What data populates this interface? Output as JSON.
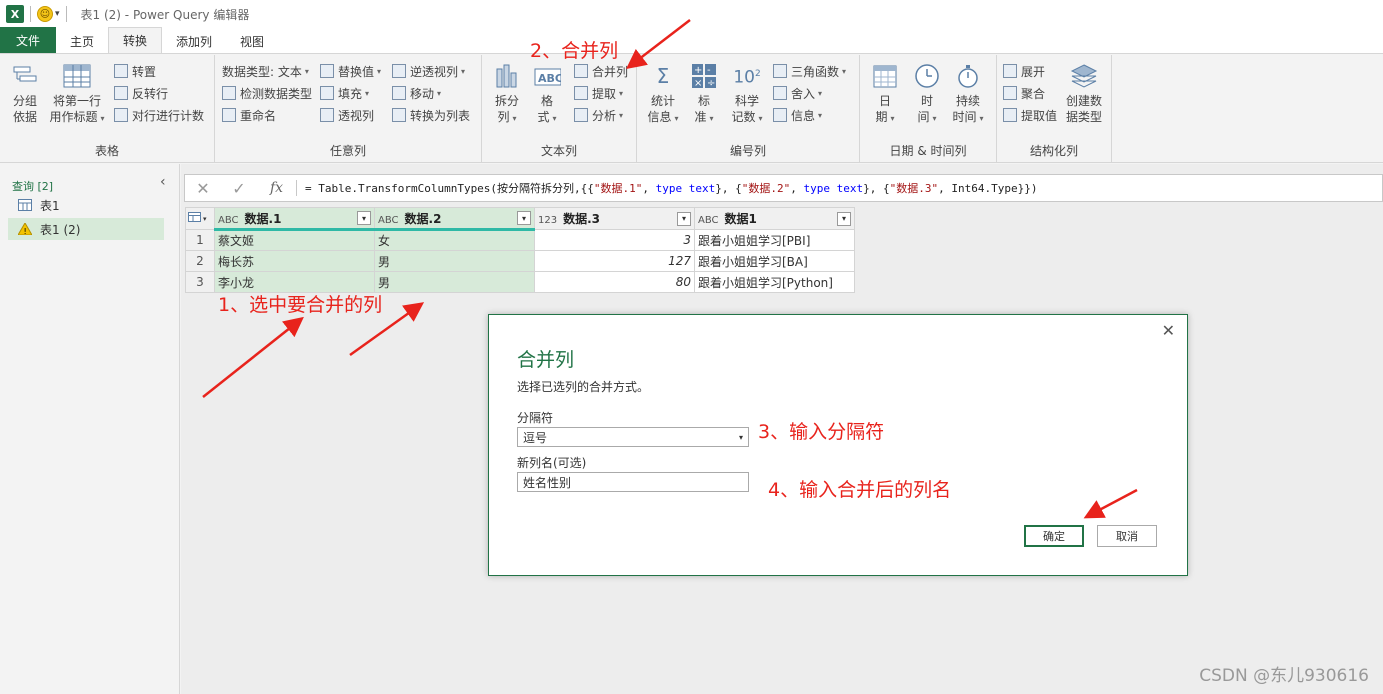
{
  "window": {
    "title": "表1 (2) - Power Query 编辑器",
    "quick_access_dropdown": "▾"
  },
  "tabs": [
    {
      "label": "文件"
    },
    {
      "label": "主页"
    },
    {
      "label": "转换"
    },
    {
      "label": "添加列"
    },
    {
      "label": "视图"
    }
  ],
  "ribbon": {
    "groups": {
      "table": "表格",
      "any_column": "任意列",
      "text_column": "文本列",
      "number_column": "编号列",
      "datetime_column": "日期 & 时间列",
      "structured_column": "结构化列"
    },
    "table": {
      "group_by_l1": "分组",
      "group_by_l2": "依据",
      "first_row_l1": "将第一行",
      "first_row_l2": "用作标题",
      "transpose": "转置",
      "reverse_rows": "反转行",
      "count_rows": "对行进行计数"
    },
    "any_column": {
      "data_type": "数据类型: 文本",
      "detect_type": "检测数据类型",
      "rename": "重命名",
      "replace_values": "替换值",
      "fill": "填充",
      "pivot": "透视列",
      "unpivot": "逆透视列",
      "move": "移动",
      "to_list": "转换为列表"
    },
    "text_column": {
      "split_l1": "拆分",
      "split_l2": "列",
      "format_l1": "格",
      "format_l2": "式",
      "merge": "合并列",
      "extract": "提取",
      "parse": "分析"
    },
    "number_column": {
      "stats_l1": "统计",
      "stats_l2": "信息",
      "standard_l1": "标",
      "standard_l2": "准",
      "scientific_l1": "科学",
      "scientific_l2": "记数",
      "trig": "三角函数",
      "rounding": "舍入",
      "info": "信息"
    },
    "datetime_column": {
      "date_l1": "日",
      "date_l2": "期",
      "time_l1": "时",
      "time_l2": "间",
      "duration_l1": "持续",
      "duration_l2": "时间"
    },
    "structured_column": {
      "expand": "展开",
      "aggregate": "聚合",
      "extract_values": "提取值",
      "create_type_l1": "创建数",
      "create_type_l2": "据类型"
    }
  },
  "queries": {
    "header": "查询 [2]",
    "items": [
      {
        "label": "表1"
      },
      {
        "label": "表1 (2)"
      }
    ]
  },
  "formula_bar": {
    "cancel": "✕",
    "commit": "✓",
    "fx": "fx",
    "p1": "= Table.TransformColumnTypes(按分隔符拆分列,{{",
    "s1": "\"数据.1\"",
    "p2": ", ",
    "k1": "type text",
    "p3": "}, {",
    "s2": "\"数据.2\"",
    "p4": ", ",
    "k2": "type text",
    "p5": "}, {",
    "s3": "\"数据.3\"",
    "p6": ", Int64.Type}})"
  },
  "grid": {
    "columns": [
      {
        "name": "数据.1",
        "type_icon": "ABC"
      },
      {
        "name": "数据.2",
        "type_icon": "ABC"
      },
      {
        "name": "数据.3",
        "type_icon": "123"
      },
      {
        "name": "数据1",
        "type_icon": "ABC"
      }
    ],
    "rows": [
      {
        "n": "1",
        "c1": "蔡文姬",
        "c2": "女",
        "c3": "3",
        "c4": "跟着小姐姐学习[PBI]"
      },
      {
        "n": "2",
        "c1": "梅长苏",
        "c2": "男",
        "c3": "127",
        "c4": "跟着小姐姐学习[BA]"
      },
      {
        "n": "3",
        "c1": "李小龙",
        "c2": "男",
        "c3": "80",
        "c4": "跟着小姐姐学习[Python]"
      }
    ]
  },
  "dialog": {
    "title": "合并列",
    "description": "选择已选列的合并方式。",
    "separator_label": "分隔符",
    "separator_value": "逗号",
    "new_name_label": "新列名(可选)",
    "new_name_value": "姓名性别",
    "ok": "确定",
    "cancel": "取消",
    "close": "✕"
  },
  "annotations": {
    "a1": "1、选中要合并的列",
    "a2": "2、合并列",
    "a3": "3、输入分隔符",
    "a4": "4、输入合并后的列名"
  },
  "watermark": "CSDN @东儿930616",
  "colors": {
    "excel_green": "#217346",
    "annotation_red": "#e8231c",
    "selected_col": "#d7ead9",
    "header_accent": "#2fb9a6"
  }
}
